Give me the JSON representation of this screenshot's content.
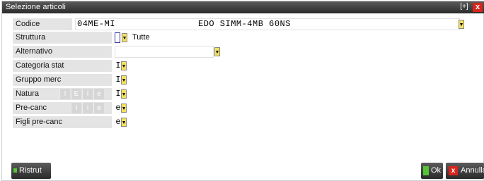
{
  "window": {
    "title": "Selezione articoli"
  },
  "titlebar": {
    "max_glyph": "[+]",
    "close_glyph": "x"
  },
  "codice": {
    "label": "Codice",
    "code": "04ME-MI",
    "description": "EDO SIMM-4MB 60NS"
  },
  "struttura": {
    "label": "Struttura",
    "value": "Tutte"
  },
  "alternativo": {
    "label": "Alternativo",
    "value": ""
  },
  "categoria_stat": {
    "label": "Categoria stat",
    "value": "I"
  },
  "gruppo_merc": {
    "label": "Gruppo merc",
    "value": "I"
  },
  "natura": {
    "label": "Natura",
    "options": [
      "I",
      "E",
      "i",
      "e"
    ],
    "value": "I"
  },
  "pre_canc": {
    "label": "Pre-canc",
    "options": [
      "I",
      "i",
      "e"
    ],
    "value": "e"
  },
  "figli_pre_canc": {
    "label": "Figli pre-canc",
    "value": "e"
  },
  "buttons": {
    "ristrut": "Ristrut",
    "ok": "Ok",
    "annulla": "Annulla"
  },
  "colors": {
    "dropdown": "#f4e15a",
    "close": "#d8261d",
    "ok_icon": "#55c534"
  },
  "icons": {
    "dropdown": "chevron-down-icon",
    "close": "close-icon",
    "maximize": "maximize-icon"
  }
}
